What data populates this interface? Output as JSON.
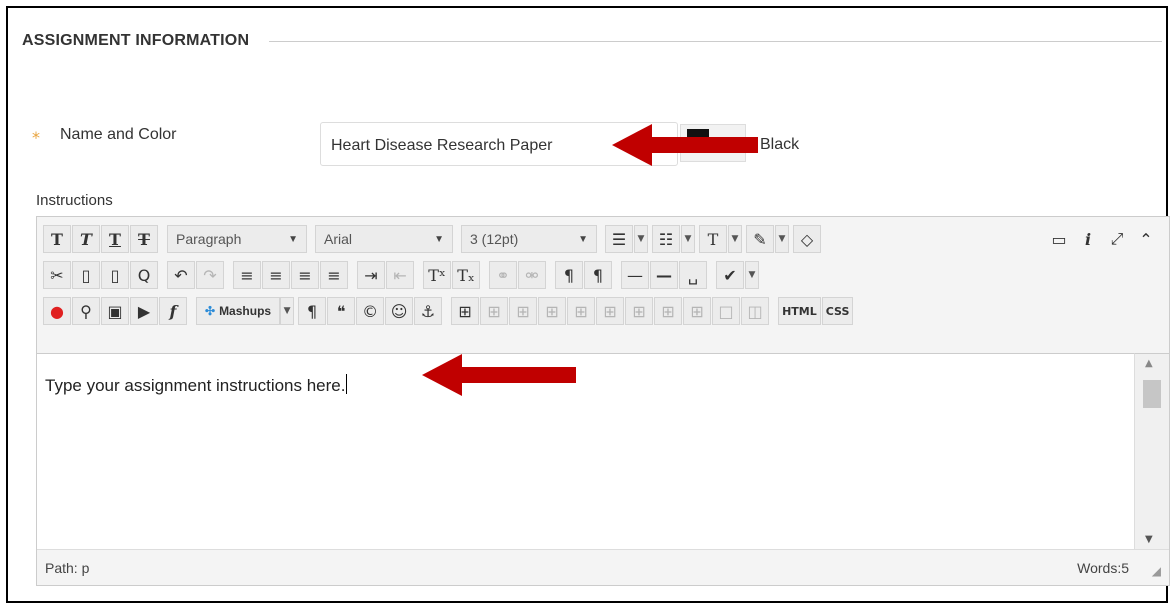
{
  "section": {
    "title": "ASSIGNMENT INFORMATION"
  },
  "name_field": {
    "required_marker": "*",
    "label": "Name and Color",
    "value": "Heart Disease Research Paper",
    "color_name": "Black"
  },
  "instructions": {
    "label": "Instructions",
    "toolbar": {
      "format_select": "Paragraph",
      "font_select": "Arial",
      "size_select": "3 (12pt)",
      "mashups_label": "Mashups",
      "html_label": "HTML",
      "css_label": "CSS"
    },
    "body_text": "Type your assignment instructions here.",
    "path_label": "Path: p",
    "word_count": "Words:5"
  },
  "colors": {
    "annotation_arrow": "#c00000",
    "required_star": "#e8a33d"
  }
}
